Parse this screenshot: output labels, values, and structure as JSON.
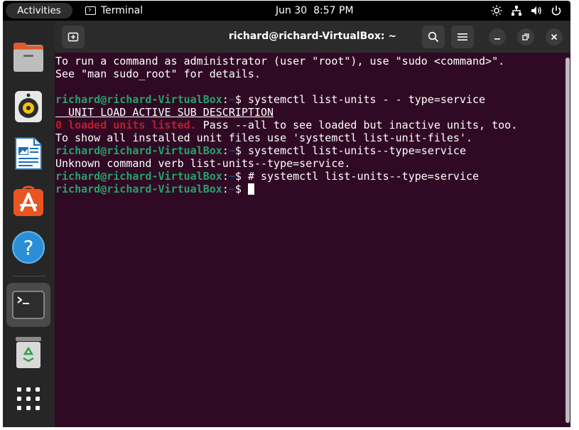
{
  "topbar": {
    "activities": "Activities",
    "app_name": "Terminal",
    "date": "Jun 30",
    "time": "8:57 PM",
    "tray_icons": [
      "brightness-icon",
      "network-icon",
      "volume-icon",
      "power-icon"
    ]
  },
  "dock": {
    "items": [
      {
        "name": "Files",
        "icon": "files-icon"
      },
      {
        "name": "Rhythmbox",
        "icon": "rhythmbox-icon"
      },
      {
        "name": "LibreOffice Writer",
        "icon": "writer-icon"
      },
      {
        "name": "Ubuntu Software",
        "icon": "software-icon"
      },
      {
        "name": "Help",
        "icon": "help-icon"
      },
      {
        "name": "Terminal",
        "icon": "terminal-icon",
        "running": true
      },
      {
        "name": "Trash",
        "icon": "trash-icon"
      },
      {
        "name": "Show Applications",
        "icon": "app-grid-icon"
      }
    ]
  },
  "window": {
    "title": "richard@richard-VirtualBox: ~"
  },
  "terminal": {
    "prompt_user": "richard@richard-VirtualBox",
    "prompt_colon": ":",
    "prompt_path": "~",
    "prompt_dollar": "$ ",
    "line1": "To run a command as administrator (user \"root\"), use \"sudo <command>\".",
    "line2": "See \"man sudo_root\" for details.",
    "cmd1": "systemctl list-units - - type=service",
    "header": "  UNIT LOAD ACTIVE SUB DESCRIPTION",
    "err_text": "0 loaded units listed.",
    "after_err": " Pass --all to see loaded but inactive units, too.",
    "hint": "To show all installed unit files use 'systemctl list-unit-files'.",
    "cmd2": "systemctl list-units--type=service",
    "unknown": "Unknown command verb list-units--type=service.",
    "cmd3": "# systemctl list-units--type=service"
  },
  "colors": {
    "terminal_bg": "#300a24",
    "prompt_user": "#26a269",
    "prompt_path": "#12488b",
    "error": "#c01c28",
    "accent": "#e95420"
  }
}
